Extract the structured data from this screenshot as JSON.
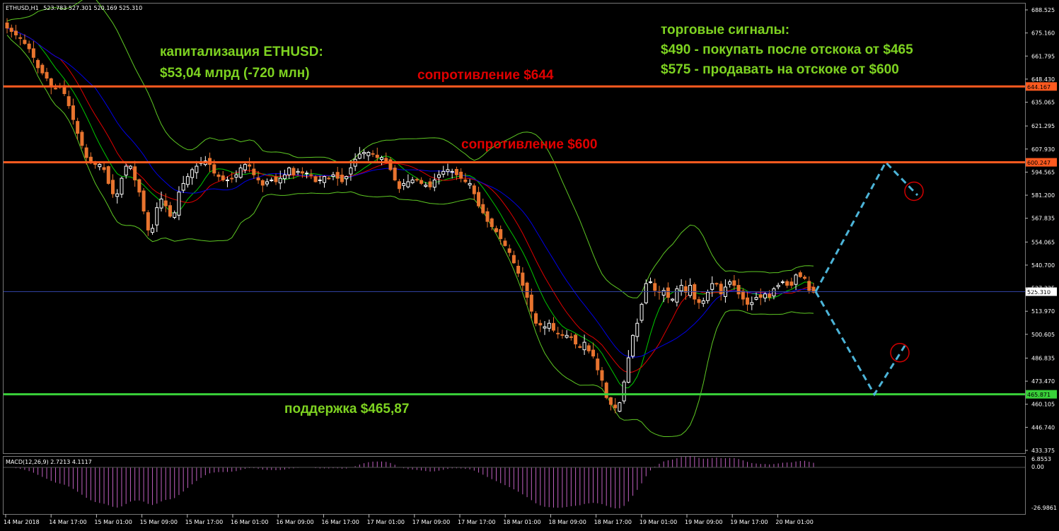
{
  "header": {
    "symbol": "ETHUSD,H1",
    "ohlc": "523.783 527.301 520.169 525.310"
  },
  "annotations": {
    "cap_title": "капитализация ETHUSD:",
    "cap_value": "$53,04 млрд (-720 млн)",
    "res644": "сопротивление $644",
    "res600": "сопротивление $600",
    "support": "поддержка $465,87",
    "signals_title": "торговые сигналы:",
    "signal_buy": "$490 - покупать после отскока от $465",
    "signal_sell": "$575 - продавать на отскоке от $600"
  },
  "macd": {
    "label": "MACD(12,26,9) 2.7213 4.1117",
    "axis_labels": [
      "6.8553",
      "0.00",
      "-26.9861"
    ]
  },
  "colors": {
    "background": "#000000",
    "bull_candle": "#FFFFFF",
    "bear_candle": "#E8742F",
    "resistance_line": "#FF5A1F",
    "support_line": "#39D039",
    "bb_band": "#5EC823",
    "ma_fast": "#00C800",
    "ma_mid": "#E00000",
    "ma_slow": "#0000E6",
    "forecast": "#4CB4D8",
    "circle": "#D00000",
    "price_marker": "#FF5A1F",
    "support_marker": "#39D039",
    "macd_hist": "#C060C0"
  },
  "chart_data": {
    "type": "candlestick",
    "price_axis_ticks": [
      "688.525",
      "675.160",
      "661.795",
      "648.430",
      "635.065",
      "621.295",
      "607.930",
      "594.565",
      "581.200",
      "567.835",
      "554.065",
      "540.700",
      "527.335",
      "513.970",
      "500.605",
      "486.835",
      "473.470",
      "460.105",
      "446.740",
      "433.375"
    ],
    "time_labels": [
      "14 Mar 2018",
      "14 Mar 17:00",
      "15 Mar 01:00",
      "15 Mar 09:00",
      "15 Mar 17:00",
      "16 Mar 01:00",
      "16 Mar 09:00",
      "16 Mar 17:00",
      "17 Mar 01:00",
      "17 Mar 09:00",
      "17 Mar 17:00",
      "18 Mar 01:00",
      "18 Mar 09:00",
      "18 Mar 17:00",
      "19 Mar 01:00",
      "19 Mar 09:00",
      "19 Mar 17:00",
      "20 Mar 01:00"
    ],
    "levels": [
      {
        "name": "resistance-644",
        "price": 644.167,
        "label": "644.167"
      },
      {
        "name": "resistance-600",
        "price": 600.247,
        "label": "600.247"
      },
      {
        "name": "support-465",
        "price": 465.871,
        "label": "465.871"
      }
    ],
    "current_price": {
      "price": 525.31,
      "label": "525.310"
    },
    "closes": [
      678,
      676,
      674,
      672,
      669,
      666,
      661,
      655,
      652,
      649,
      644,
      643,
      644,
      640,
      633,
      625,
      617,
      610,
      603,
      600,
      599,
      599,
      596,
      588,
      582,
      582,
      591,
      598,
      598,
      590,
      583,
      572,
      561,
      562,
      574,
      579,
      575,
      569,
      571,
      583,
      588,
      592,
      596,
      598,
      600,
      601,
      599,
      594,
      592,
      590,
      590,
      591,
      593,
      597,
      599,
      598,
      593,
      590,
      587,
      589,
      590,
      589,
      591,
      593,
      597,
      593,
      595,
      594,
      594,
      593,
      589,
      590,
      592,
      591,
      593,
      591,
      589,
      592,
      597,
      602,
      605,
      606,
      606,
      605,
      603,
      603,
      601,
      596,
      590,
      585,
      588,
      589,
      590,
      590,
      588,
      587,
      586,
      590,
      593,
      595,
      596,
      595,
      593,
      591,
      589,
      588,
      582,
      575,
      571,
      566,
      563,
      560,
      556,
      552,
      548,
      542,
      536,
      529,
      522,
      514,
      507,
      506,
      505,
      507,
      503,
      501,
      500,
      500,
      499,
      495,
      493,
      496,
      491,
      488,
      480,
      474,
      464,
      460,
      458,
      461,
      473,
      487,
      500,
      507,
      518,
      530,
      531,
      526,
      525,
      526,
      522,
      521,
      527,
      529,
      525,
      529,
      521,
      519,
      520,
      525,
      530,
      530,
      524,
      528,
      531,
      529,
      524,
      521,
      518,
      519,
      522,
      522,
      524,
      522,
      527,
      529,
      531,
      529,
      529,
      535,
      534,
      533,
      526,
      525
    ],
    "forecast": [
      525.31,
      600.247,
      581.2,
      null,
      525.31,
      465.871,
      494.0
    ]
  }
}
